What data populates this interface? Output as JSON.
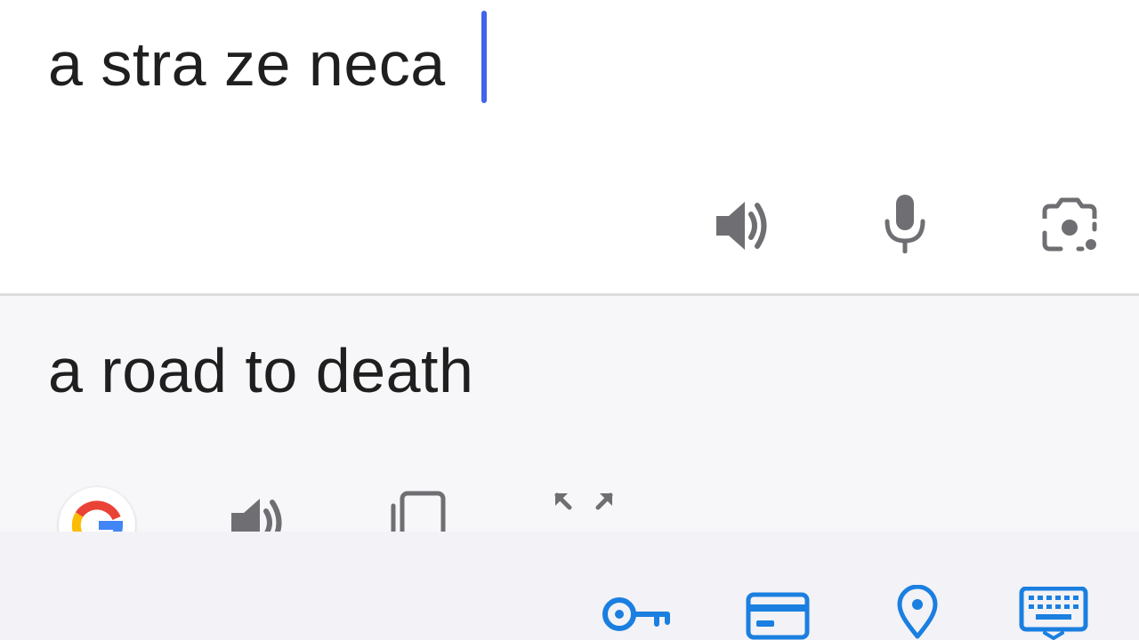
{
  "source": {
    "text": "a stra ze neca",
    "actions": [
      {
        "name": "speaker-icon"
      },
      {
        "name": "microphone-icon"
      },
      {
        "name": "camera-icon"
      }
    ]
  },
  "translation": {
    "text": "a road to death",
    "actions": [
      {
        "name": "google-logo-icon"
      },
      {
        "name": "speaker-icon"
      },
      {
        "name": "copy-icon"
      },
      {
        "name": "expand-icon"
      }
    ]
  },
  "keyboard_toolbar": {
    "items": [
      {
        "name": "key-icon"
      },
      {
        "name": "credit-card-icon"
      },
      {
        "name": "location-pin-icon"
      },
      {
        "name": "keyboard-icon"
      }
    ]
  },
  "colors": {
    "text": "#1f1f1f",
    "icon_gray": "#6f6f73",
    "cursor": "#4263eb",
    "toolbar_blue": "#1a7fe0",
    "divider": "#dcdcdf",
    "target_bg": "#f7f7f9"
  }
}
